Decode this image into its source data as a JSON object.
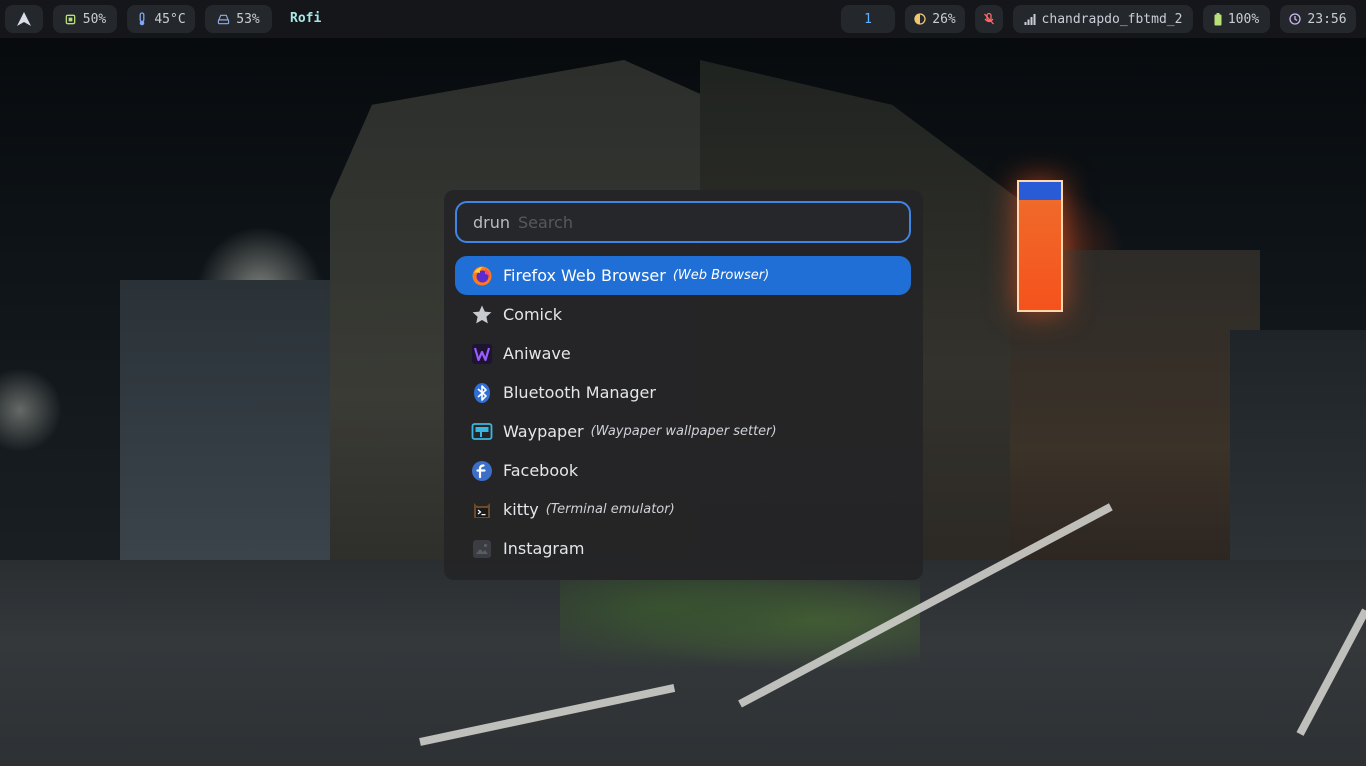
{
  "topbar": {
    "cpu": "50%",
    "temp": "45°C",
    "disk": "53%",
    "active_window": "Rofi",
    "workspace": "1",
    "brightness": "26%",
    "network": "chandrapdo_fbtmd_2",
    "battery": "100%",
    "clock": "23:56"
  },
  "rofi": {
    "mode": "drun",
    "placeholder": "Search",
    "items": [
      {
        "label": "Firefox Web Browser",
        "desc": "(Web Browser)",
        "icon": "firefox-icon"
      },
      {
        "label": "Comick",
        "desc": "",
        "icon": "star-icon"
      },
      {
        "label": "Aniwave",
        "desc": "",
        "icon": "aniwave-icon"
      },
      {
        "label": "Bluetooth Manager",
        "desc": "",
        "icon": "bluetooth-icon"
      },
      {
        "label": "Waypaper",
        "desc": "(Waypaper wallpaper setter)",
        "icon": "waypaper-icon"
      },
      {
        "label": "Facebook",
        "desc": "",
        "icon": "fedora-icon"
      },
      {
        "label": "kitty",
        "desc": "(Terminal emulator)",
        "icon": "kitty-icon"
      },
      {
        "label": "Instagram",
        "desc": "",
        "icon": "image-icon"
      }
    ],
    "selected_index": 0
  },
  "colors": {
    "accent": "#1f6fd6",
    "border": "#3f85e6",
    "bar_bg": "#141619",
    "pill_bg": "#24272c"
  }
}
